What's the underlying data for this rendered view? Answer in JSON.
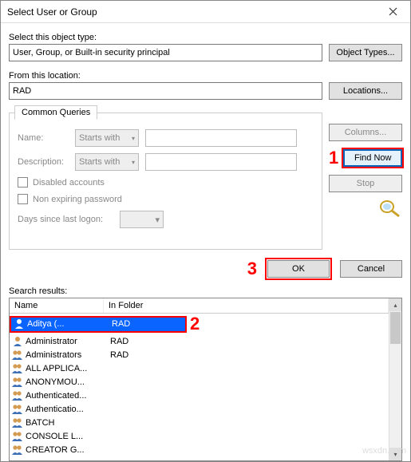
{
  "title": "Select User or Group",
  "section1": {
    "label": "Select this object type:",
    "value": "User, Group, or Built-in security principal",
    "button": "Object Types..."
  },
  "section2": {
    "label": "From this location:",
    "value": "RAD",
    "button": "Locations..."
  },
  "queries": {
    "tab": "Common Queries",
    "name_label": "Name:",
    "name_mode": "Starts with",
    "desc_label": "Description:",
    "desc_mode": "Starts with",
    "disabled_label": "Disabled accounts",
    "nonexp_label": "Non expiring password",
    "days_label": "Days since last logon:"
  },
  "side": {
    "columns": "Columns...",
    "find": "Find Now",
    "stop": "Stop"
  },
  "dlg": {
    "ok": "OK",
    "cancel": "Cancel"
  },
  "callouts": {
    "c1": "1",
    "c2": "2",
    "c3": "3"
  },
  "results": {
    "label": "Search results:",
    "col_name": "Name",
    "col_folder": "In Folder",
    "rows": [
      {
        "name": "Aditya      (...",
        "folder": "RAD",
        "type": "user",
        "selected": true
      },
      {
        "name": "Administrator",
        "folder": "RAD",
        "type": "user"
      },
      {
        "name": "Administrators",
        "folder": "RAD",
        "type": "group"
      },
      {
        "name": "ALL APPLICA...",
        "folder": "",
        "type": "group"
      },
      {
        "name": "ANONYMOU...",
        "folder": "",
        "type": "group"
      },
      {
        "name": "Authenticated...",
        "folder": "",
        "type": "group"
      },
      {
        "name": "Authenticatio...",
        "folder": "",
        "type": "group"
      },
      {
        "name": "BATCH",
        "folder": "",
        "type": "group"
      },
      {
        "name": "CONSOLE L...",
        "folder": "",
        "type": "group"
      },
      {
        "name": "CREATOR G...",
        "folder": "",
        "type": "group"
      }
    ]
  },
  "watermark": "wsxdn.com"
}
